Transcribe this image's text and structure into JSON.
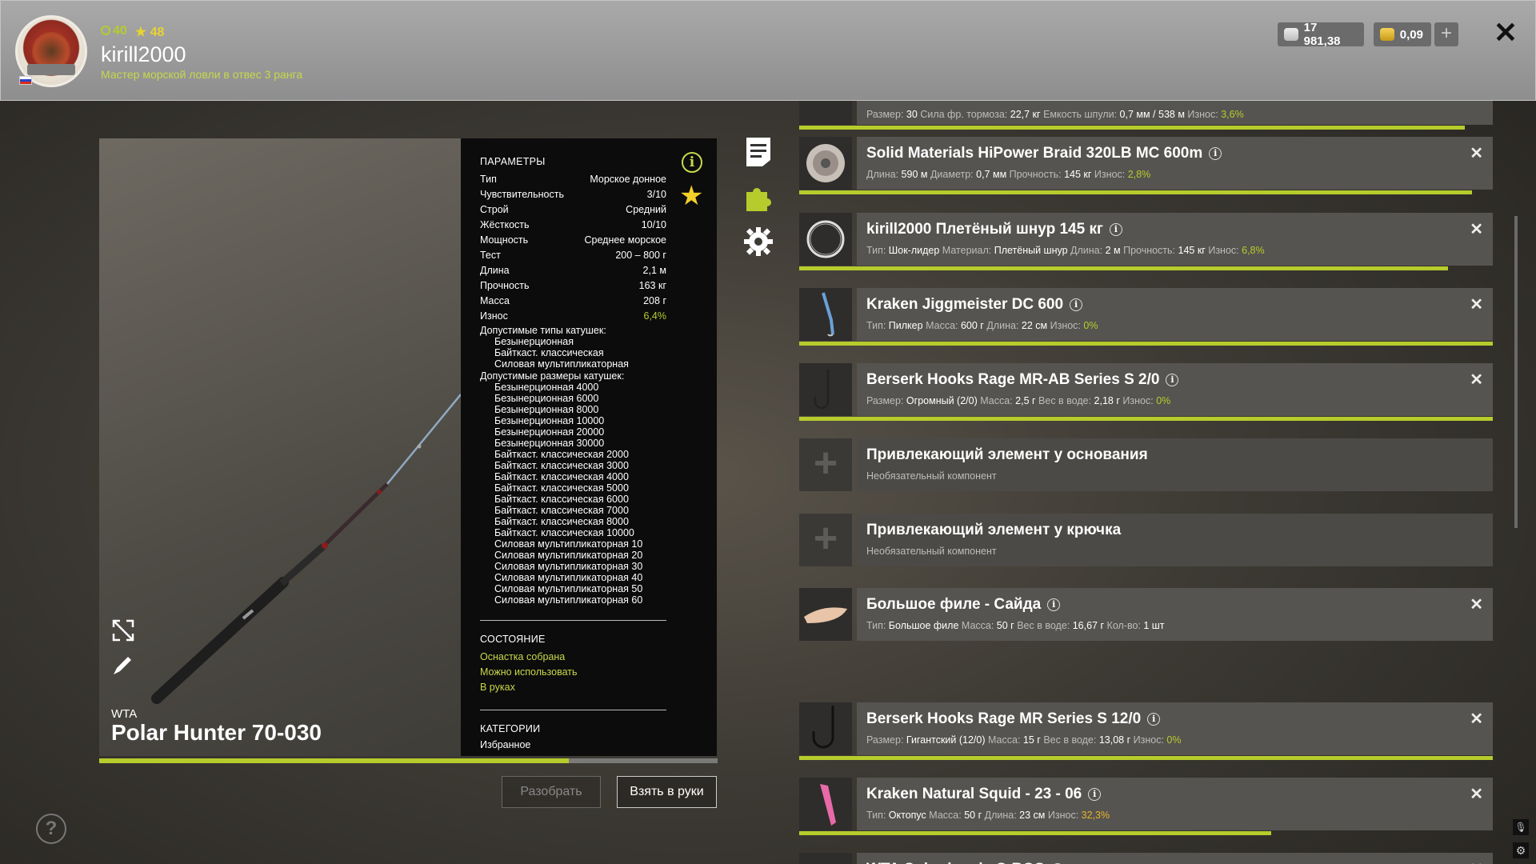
{
  "header": {
    "level": "40",
    "rating": "48",
    "username": "kirill2000",
    "rank": "Мастер морской ловли в отвес 3 ранга",
    "silver": "17 981,38",
    "gold": "0,09",
    "add_label": "+",
    "close_label": "✕"
  },
  "rod": {
    "brand": "WTA",
    "name": "Polar Hunter 70-030",
    "condition_progress": 0.76
  },
  "params": {
    "title": "ПАРАМЕТРЫ",
    "rows": [
      {
        "label": "Тип",
        "value": "Морское донное"
      },
      {
        "label": "Чувствительность",
        "value": "3/10"
      },
      {
        "label": "Строй",
        "value": "Средний"
      },
      {
        "label": "Жёсткость",
        "value": "10/10"
      },
      {
        "label": "Мощность",
        "value": "Среднее морское"
      },
      {
        "label": "Тест",
        "value": "200 – 800 г"
      },
      {
        "label": "Длина",
        "value": "2,1 м"
      },
      {
        "label": "Прочность",
        "value": "163 кг"
      },
      {
        "label": "Масса",
        "value": "208 г"
      },
      {
        "label": "Износ",
        "value": "6,4%"
      }
    ],
    "reel_types_title": "Допустимые типы катушек:",
    "reel_types": [
      "Безынерционная",
      "Байткаст. классическая",
      "Силовая мультипликаторная"
    ],
    "reel_sizes_title": "Допустимые размеры катушек:",
    "reel_sizes": [
      "Безынерционная 4000",
      "Безынерционная 6000",
      "Безынерционная 8000",
      "Безынерционная 10000",
      "Безынерционная 20000",
      "Безынерционная 30000",
      "Байткаст. классическая 2000",
      "Байткаст. классическая 3000",
      "Байткаст. классическая 4000",
      "Байткаст. классическая 5000",
      "Байткаст. классическая 6000",
      "Байткаст. классическая 7000",
      "Байткаст. классическая 8000",
      "Байткаст. классическая 10000",
      "Силовая мультипликаторная 10",
      "Силовая мультипликаторная 20",
      "Силовая мультипликаторная 30",
      "Силовая мультипликаторная 40",
      "Силовая мультипликаторная 50",
      "Силовая мультипликаторная 60"
    ],
    "state_title": "СОСТОЯНИЕ",
    "state_items": [
      "Оснастка собрана",
      "Можно использовать",
      "В руках"
    ],
    "categories_title": "КАТЕГОРИИ",
    "categories_value": "Избранное"
  },
  "buttons": {
    "disassemble": "Разобрать",
    "take": "Взять в руки"
  },
  "tackle": [
    {
      "partial": true,
      "props_html": [
        [
          "Размер:",
          "30"
        ],
        [
          "Сила фр. тормоза:",
          "22,7 кг"
        ],
        [
          "Емкость шпули:",
          "0,7 мм / 538 м"
        ]
      ],
      "wear_label": "Износ:",
      "wear": "3,6%",
      "wear_orange": false,
      "bar": 0.96
    },
    {
      "title": "Solid Materials HiPower Braid 320LB MC 600m",
      "props_html": [
        [
          "Длина:",
          "590 м"
        ],
        [
          "Диаметр:",
          "0,7 мм"
        ],
        [
          "Прочность:",
          "145 кг"
        ]
      ],
      "wear_label": "Износ:",
      "wear": "2,8%",
      "wear_orange": false,
      "bar": 0.97,
      "thumb": "spool"
    },
    {
      "title": "kirill2000 Плетёный шнур 145 кг",
      "props_html": [
        [
          "Тип:",
          "Шок-лидер"
        ],
        [
          "Материал:",
          "Плетёный шнур"
        ],
        [
          "Длина:",
          "2 м"
        ],
        [
          "Прочность:",
          "145 кг"
        ]
      ],
      "wear_label": "Износ:",
      "wear": "6,8%",
      "wear_orange": false,
      "bar": 0.935,
      "thumb": "coil"
    },
    {
      "title": "Kraken Jiggmeister DC 600",
      "props_html": [
        [
          "Тип:",
          "Пилкер"
        ],
        [
          "Масса:",
          "600 г"
        ],
        [
          "Длина:",
          "22 см"
        ]
      ],
      "wear_label": "Износ:",
      "wear": "0%",
      "wear_orange": false,
      "bar": 1.0,
      "thumb": "jig"
    },
    {
      "title": "Berserk Hooks Rage MR-AB Series S 2/0",
      "props_html": [
        [
          "Размер:",
          "Огромный (2/0)"
        ],
        [
          "Масса:",
          "2,5 г"
        ],
        [
          "Вес в воде:",
          "2,18 г"
        ]
      ],
      "wear_label": "Износ:",
      "wear": "0%",
      "wear_orange": false,
      "bar": 1.0,
      "thumb": "hook"
    },
    {
      "title": "Привлекающий элемент у основания",
      "subtitle": "Необязательный компонент",
      "empty": true
    },
    {
      "title": "Привлекающий элемент у крючка",
      "subtitle": "Необязательный компонент",
      "empty": true
    },
    {
      "title": "Большое филе - Сайда",
      "props_html": [
        [
          "Тип:",
          "Большое филе"
        ],
        [
          "Масса:",
          "50 г"
        ],
        [
          "Вес в воде:",
          "16,67 г"
        ],
        [
          "Кол-во:",
          "1 шт"
        ]
      ],
      "thumb": "fillet",
      "no_bar": true
    },
    {
      "title": "Berserk Hooks Rage MR Series S 12/0",
      "props_html": [
        [
          "Размер:",
          "Гигантский (12/0)"
        ],
        [
          "Масса:",
          "15 г"
        ],
        [
          "Вес в воде:",
          "13,08 г"
        ]
      ],
      "wear_label": "Износ:",
      "wear": "0%",
      "wear_orange": false,
      "bar": 1.0,
      "thumb": "bighook"
    },
    {
      "title": "Kraken Natural Squid - 23 - 06",
      "props_html": [
        [
          "Тип:",
          "Октопус"
        ],
        [
          "Масса:",
          "50 г"
        ],
        [
          "Длина:",
          "23 см"
        ]
      ],
      "wear_label": "Износ:",
      "wear": "32,3%",
      "wear_orange": true,
      "bar": 0.68,
      "thumb": "squid"
    },
    {
      "title": "WTA Color beads C-ROS",
      "props_html": [],
      "thumb": "bead",
      "no_bar": true
    }
  ],
  "footer": {
    "help_label": "?"
  }
}
